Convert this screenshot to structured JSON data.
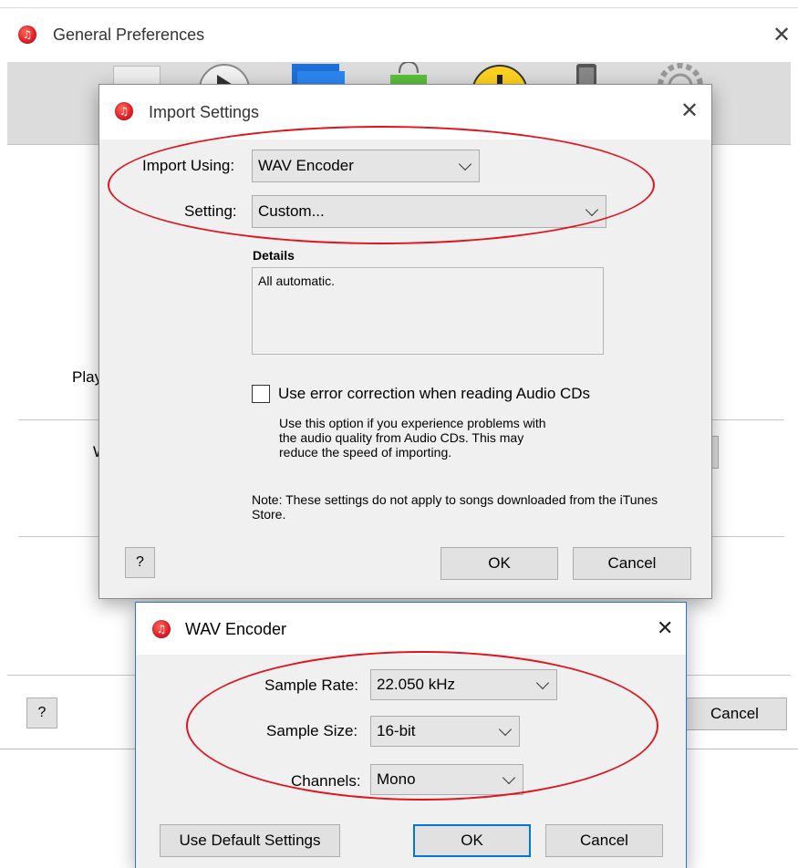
{
  "general": {
    "title": "General Preferences",
    "play_label": "Play",
    "w_label": "W",
    "help_label": "?",
    "cancel_label": "Cancel"
  },
  "import_dialog": {
    "title": "Import Settings",
    "import_using_label": "Import Using:",
    "import_using_value": "WAV Encoder",
    "setting_label": "Setting:",
    "setting_value": "Custom...",
    "details_heading": "Details",
    "details_text": "All automatic.",
    "error_correction_label": "Use error correction when reading Audio CDs",
    "error_correction_checked": false,
    "error_correction_help": "Use this option if you experience problems with the audio quality from Audio CDs.  This may reduce the speed of importing.",
    "note_text": "Note: These settings do not apply to songs downloaded from the iTunes Store.",
    "help_label": "?",
    "ok_label": "OK",
    "cancel_label": "Cancel"
  },
  "wav_dialog": {
    "title": "WAV Encoder",
    "sample_rate_label": "Sample Rate:",
    "sample_rate_value": "22.050 kHz",
    "sample_size_label": "Sample Size:",
    "sample_size_value": "16-bit",
    "channels_label": "Channels:",
    "channels_value": "Mono",
    "default_settings_label": "Use Default Settings",
    "ok_label": "OK",
    "cancel_label": "Cancel"
  },
  "colors": {
    "annotation_red": "#e0141e",
    "focus_blue": "#0078d7",
    "itunes_red": "#e8202a"
  },
  "icons": [
    "itunes-icon",
    "close-icon",
    "chevron-down-icon",
    "checkbox-icon",
    "play-icon",
    "stack-icon",
    "bag-icon",
    "warning-icon",
    "device-icon",
    "gear-icon"
  ]
}
